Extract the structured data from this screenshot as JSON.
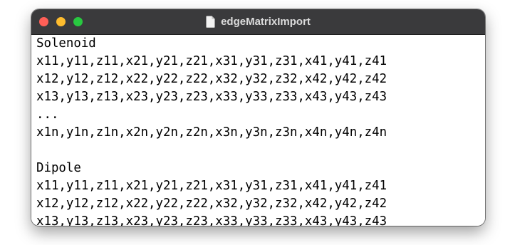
{
  "window": {
    "title": "edgeMatrixImport",
    "accent_colors": {
      "close": "#ff5f57",
      "minimize": "#febc2e",
      "zoom": "#28c840",
      "titlebar": "#3a3a3c"
    }
  },
  "document": {
    "lines": [
      "Solenoid",
      "x11,y11,z11,x21,y21,z21,x31,y31,z31,x41,y41,z41",
      "x12,y12,z12,x22,y22,z22,x32,y32,z32,x42,y42,z42",
      "x13,y13,z13,x23,y23,z23,x33,y33,z33,x43,y43,z43",
      "...",
      "x1n,y1n,z1n,x2n,y2n,z2n,x3n,y3n,z3n,x4n,y4n,z4n",
      "",
      "Dipole",
      "x11,y11,z11,x21,y21,z21,x31,y31,z31,x41,y41,z41",
      "x12,y12,z12,x22,y22,z22,x32,y32,z32,x42,y42,z42",
      "x13,y13,z13,x23,y23,z23,x33,y33,z33,x43,y43,z43"
    ]
  }
}
